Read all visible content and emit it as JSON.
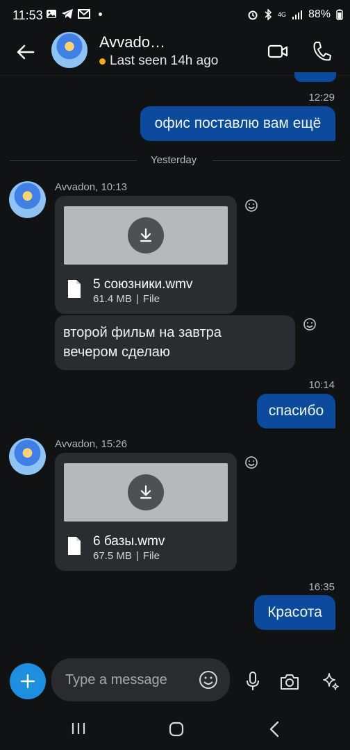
{
  "status_bar": {
    "time": "11:53",
    "battery": "88%",
    "network": "4G"
  },
  "header": {
    "back_icon": "arrow-left-icon",
    "contact_name": "Avvado…",
    "last_seen": "Last seen 14h ago",
    "presence_color": "#f2b100",
    "video_icon": "video-camera-icon",
    "call_icon": "phone-icon"
  },
  "messages": [
    {
      "type": "time",
      "text": "12:29"
    },
    {
      "type": "outgoing",
      "text": "офис поставлю вам ещё"
    },
    {
      "type": "divider",
      "text": "Yesterday"
    },
    {
      "type": "sender",
      "text": "Avvadon, 10:13"
    },
    {
      "type": "file",
      "name": "5 союзники.wmv",
      "size": "61.4 MB",
      "kind": "File"
    },
    {
      "type": "incoming",
      "line1": "второй фильм на завтра",
      "line2": "вечером сделаю"
    },
    {
      "type": "time",
      "text": "10:14"
    },
    {
      "type": "outgoing",
      "text": "спасибо"
    },
    {
      "type": "sender",
      "text": "Avvadon, 15:26"
    },
    {
      "type": "file",
      "name": "6 базы.wmv",
      "size": "67.5 MB",
      "kind": "File"
    },
    {
      "type": "time",
      "text": "16:35"
    },
    {
      "type": "outgoing",
      "text": "Красота"
    }
  ],
  "composer": {
    "placeholder": "Type a message",
    "add_icon": "plus-icon",
    "emoji_icon": "emoji-icon",
    "mic_icon": "microphone-icon",
    "camera_icon": "camera-icon",
    "ai_icon": "sparkle-icon"
  },
  "colors": {
    "background": "#111214",
    "outgoing_bubble": "#0b4a9d",
    "incoming_bubble": "#2b2c2f",
    "accent": "#1d8fe1"
  }
}
